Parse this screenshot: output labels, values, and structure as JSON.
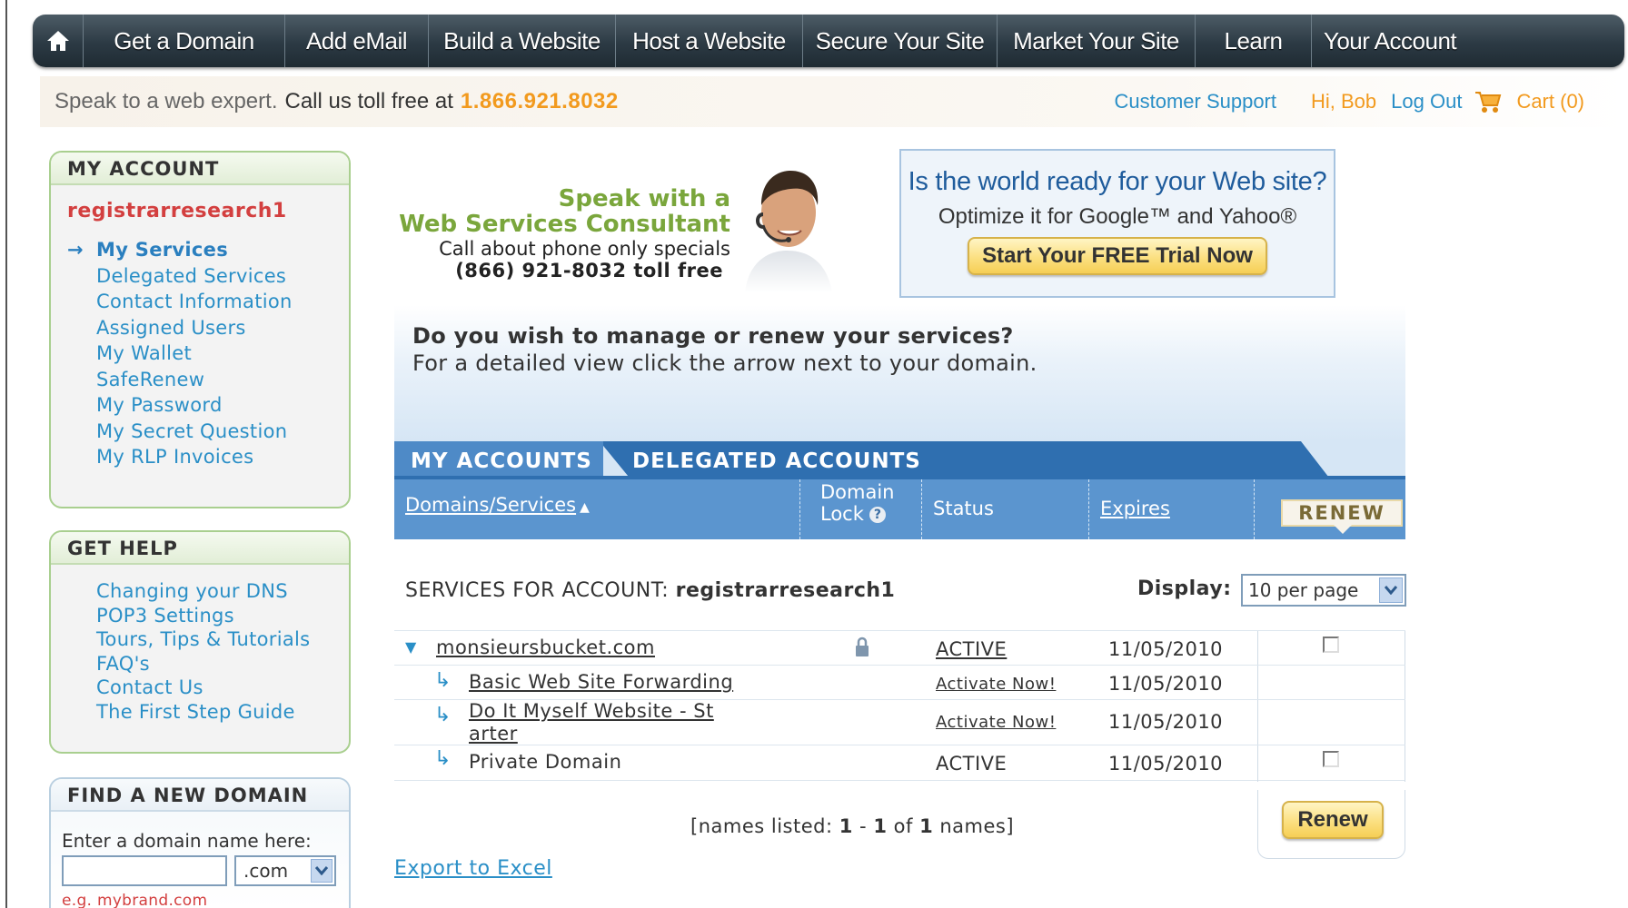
{
  "nav": {
    "items": [
      "Get a Domain",
      "Add eMail",
      "Build a Website",
      "Host a Website",
      "Secure Your Site",
      "Market Your Site",
      "Learn",
      "Your Account"
    ]
  },
  "contact": {
    "speak": "Speak to a web expert.",
    "call": "Call us toll free at",
    "phone": "1.866.921.8032",
    "customer_support": "Customer Support",
    "greeting": "Hi, Bob",
    "logout": "Log Out",
    "cart": "Cart (0)"
  },
  "my_account": {
    "title": "MY ACCOUNT",
    "account_name": "registrarresearch1",
    "items": [
      "My Services",
      "Delegated Services",
      "Contact Information",
      "Assigned Users",
      "My Wallet",
      "SafeRenew",
      "My Password",
      "My Secret Question",
      "My RLP Invoices"
    ]
  },
  "get_help": {
    "title": "GET HELP",
    "items": [
      "Changing your DNS",
      "POP3 Settings",
      "Tours, Tips & Tutorials",
      "FAQ's",
      "Contact Us",
      "The First Step Guide"
    ]
  },
  "find_domain": {
    "title": "FIND A NEW DOMAIN",
    "label": "Enter a domain name here:",
    "input_value": "",
    "tld": ".com",
    "example": "e.g. mybrand.com"
  },
  "consultant": {
    "line1": "Speak with a",
    "line2": "Web Services Consultant",
    "line3": "Call about phone only specials",
    "line4": "(866) 921-8032 toll free"
  },
  "seo_promo": {
    "question": "Is the world ready for your Web site?",
    "sub": "Optimize it for Google™ and Yahoo®",
    "button": "Start Your FREE Trial Now"
  },
  "main": {
    "question": "Do you wish to manage or renew your services?",
    "detail": "For a detailed view click the arrow next to your domain.",
    "tab_mine": "MY ACCOUNTS",
    "tab_delegated": "DELEGATED ACCOUNTS",
    "columns": {
      "domains": "Domains/Services",
      "domain_lock_1": "Domain",
      "domain_lock_2": "Lock",
      "status": "Status",
      "expires": "Expires",
      "renew": "RENEW"
    },
    "services_for": "SERVICES FOR ACCOUNT:",
    "account": "registrarresearch1",
    "display_label": "Display:",
    "display_value": "10 per page",
    "rows": [
      {
        "name": "monsieursbucket.com",
        "status": "ACTIVE",
        "expires": "11/05/2010"
      },
      {
        "name": "Basic Web Site Forwarding",
        "status": "Activate Now!",
        "expires": "11/05/2010"
      },
      {
        "name_1": "Do It Myself Website - St",
        "name_2": "arter",
        "status": "Activate Now!",
        "expires": "11/05/2010"
      },
      {
        "name": "Private Domain",
        "status": "ACTIVE",
        "expires": "11/05/2010"
      }
    ],
    "names_listed_pre": "[names listed:",
    "names_from": "1",
    "names_dash": "-",
    "names_to": "1",
    "names_of": "of",
    "names_total": "1",
    "names_post": "names]",
    "renew_button": "Renew",
    "export": "Export to Excel"
  },
  "colors": {
    "nav_bg": "#2c3a44",
    "link_blue": "#2a8fc7",
    "orange": "#f29a1e",
    "account_red": "#d33f3f",
    "header_blue": "#5b95cf",
    "green_promo": "#7aa63c"
  }
}
